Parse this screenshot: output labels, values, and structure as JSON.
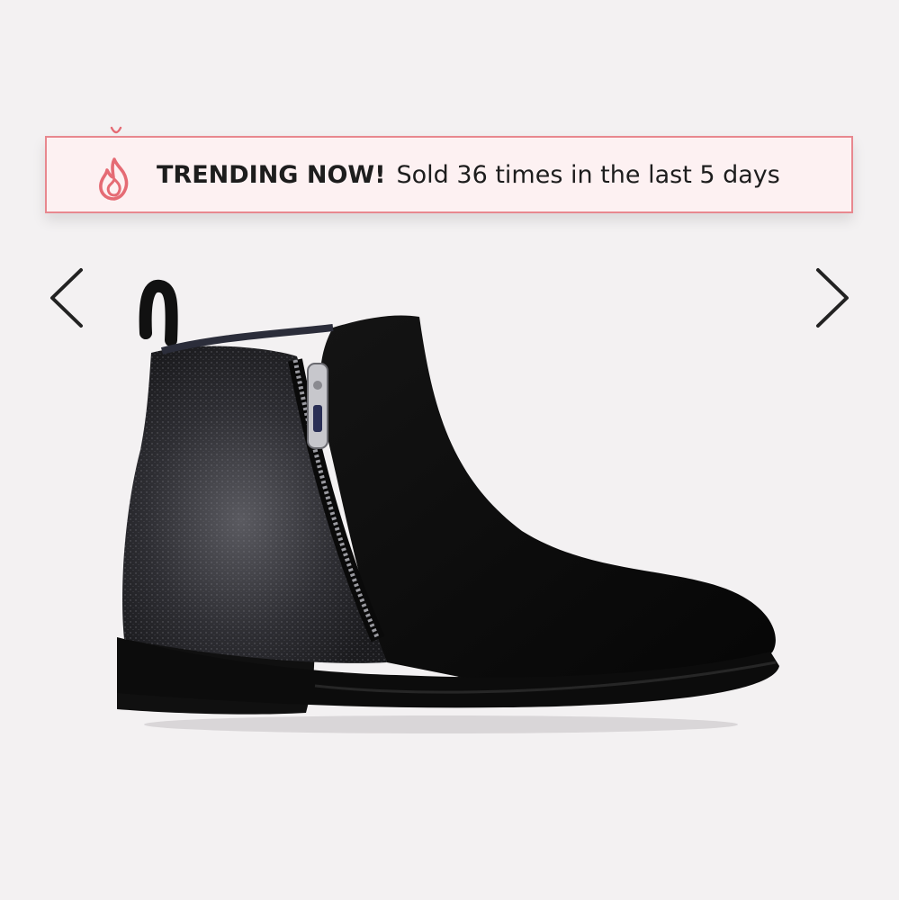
{
  "banner": {
    "bold_text": "TRENDING NOW!",
    "detail_text": "Sold 36 times in the last 5 days",
    "icon": "flame-icon",
    "accent_color": "#e8888f"
  },
  "carousel": {
    "prev_icon": "chevron-left-icon",
    "next_icon": "chevron-right-icon"
  },
  "product": {
    "image_subject": "black ankle boot with side zipper"
  }
}
